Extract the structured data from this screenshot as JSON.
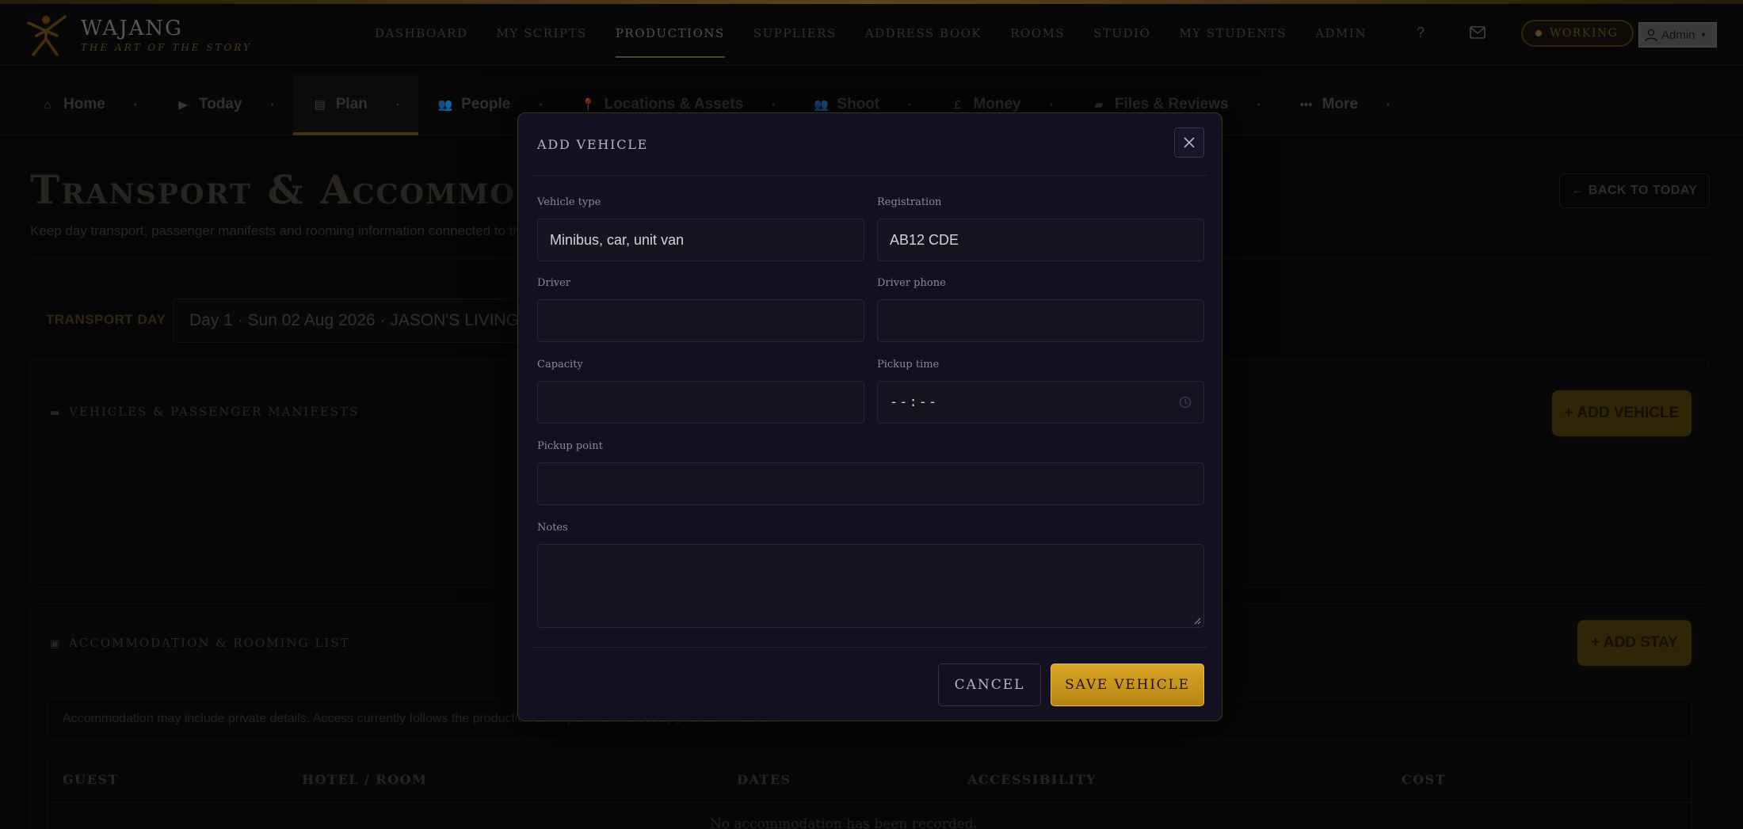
{
  "app": {
    "name": "WAJANG",
    "tagline": "THE ART OF THE STORY"
  },
  "main_nav": [
    {
      "label": "DASHBOARD"
    },
    {
      "label": "MY SCRIPTS"
    },
    {
      "label": "PRODUCTIONS",
      "active": true
    },
    {
      "label": "SUPPLIERS"
    },
    {
      "label": "ADDRESS BOOK"
    },
    {
      "label": "ROOMS"
    },
    {
      "label": "STUDIO"
    },
    {
      "label": "MY STUDENTS"
    },
    {
      "label": "ADMIN"
    }
  ],
  "header": {
    "help_label": "?",
    "status_label": "WORKING",
    "user_label": "Admin",
    "user_caret": "▾"
  },
  "sub_nav": [
    {
      "label": "Home",
      "icon": "home-icon",
      "glyph": "⌂"
    },
    {
      "label": "Today",
      "icon": "play-icon",
      "glyph": "▶"
    },
    {
      "label": "Plan",
      "icon": "clipboard-icon",
      "glyph": "▤",
      "active": true
    },
    {
      "label": "People",
      "icon": "people-icon",
      "glyph": "👥"
    },
    {
      "label": "Locations & Assets",
      "icon": "pin-icon",
      "glyph": "📍"
    },
    {
      "label": "Shoot",
      "icon": "crew-icon",
      "glyph": "👥"
    },
    {
      "label": "Money",
      "icon": "pound-icon",
      "glyph": "£"
    },
    {
      "label": "Files & Reviews",
      "icon": "folder-icon",
      "glyph": "▰"
    },
    {
      "label": "More",
      "icon": "ellipsis-icon",
      "glyph": "•••"
    }
  ],
  "page": {
    "title": "Transport & Accommodation",
    "subtitle": "Keep day transport, passenger manifests and rooming information connected to the schedule.",
    "back_label": "← BACK TO TODAY",
    "day_label": "TRANSPORT DAY",
    "day_value": "Day 1 · Sun 02 Aug 2026 · JASON'S LIVING ROOM"
  },
  "vehicles_panel": {
    "title": "VEHICLES & PASSENGER MANIFESTS",
    "add_label": "+ ADD VEHICLE"
  },
  "accommodation_panel": {
    "title": "ACCOMMODATION & ROOMING LIST",
    "add_label": "+ ADD STAY",
    "notice": "Accommodation may include private details. Access currently follows the production team permissions set by your administrator.",
    "columns": [
      "GUEST",
      "HOTEL / ROOM",
      "DATES",
      "ACCESSIBILITY",
      "COST"
    ],
    "empty_text": "No accommodation has been recorded."
  },
  "modal": {
    "title": "ADD VEHICLE",
    "fields": {
      "vehicle_type": {
        "label": "Vehicle type",
        "placeholder": "Minibus, car, unit van",
        "value": ""
      },
      "registration": {
        "label": "Registration",
        "placeholder": "AB12 CDE",
        "value": ""
      },
      "driver": {
        "label": "Driver",
        "value": ""
      },
      "driver_phone": {
        "label": "Driver phone",
        "value": ""
      },
      "capacity": {
        "label": "Capacity",
        "value": ""
      },
      "pickup_time": {
        "label": "Pickup time",
        "value": "--:--"
      },
      "pickup_point": {
        "label": "Pickup point",
        "value": ""
      },
      "notes": {
        "label": "Notes",
        "value": ""
      }
    },
    "cancel_label": "CANCEL",
    "save_label": "SAVE VEHICLE"
  }
}
